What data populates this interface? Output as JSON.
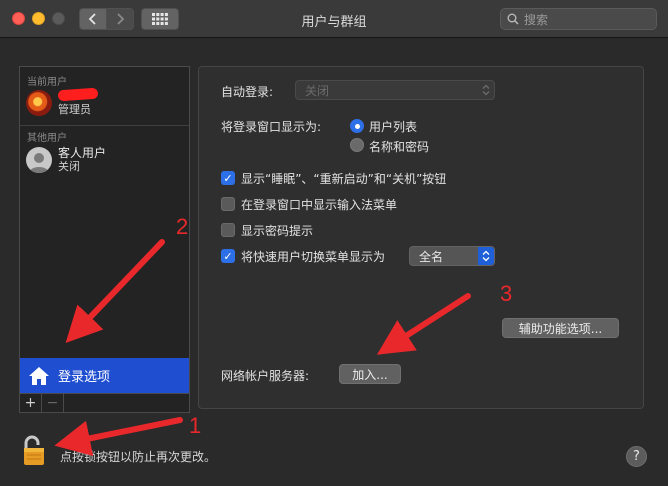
{
  "window": {
    "title": "用户与群组",
    "search_placeholder": "搜索"
  },
  "sidebar": {
    "current_users_header": "当前用户",
    "admin_role": "管理员",
    "other_users_header": "其他用户",
    "guest_name": "客人用户",
    "guest_status": "关闭",
    "login_options_label": "登录选项",
    "add_label": "+",
    "remove_label": "−"
  },
  "panel": {
    "auto_login_label": "自动登录:",
    "auto_login_value": "关闭",
    "display_login_label": "将登录窗口显示为:",
    "radio_user_list": "用户列表",
    "radio_name_password": "名称和密码",
    "check_show_buttons": "显示“睡眠”、“重新启动”和“关机”按钮",
    "check_input_menu": "在登录窗口中显示输入法菜单",
    "check_password_hint": "显示密码提示",
    "check_fast_switch": "将快速用户切换菜单显示为",
    "fast_switch_value": "全名",
    "accessibility_button": "辅助功能选项...",
    "network_server_label": "网络帐户服务器:",
    "join_button": "加入..."
  },
  "footer": {
    "lock_text": "点按锁按钮以防止再次更改。",
    "help_label": "?"
  },
  "annotations": {
    "num1": "1",
    "num2": "2",
    "num3": "3"
  },
  "colors": {
    "selection": "#1f4fd0",
    "accent": "#2d6fe6",
    "annotation": "#e8282b"
  }
}
